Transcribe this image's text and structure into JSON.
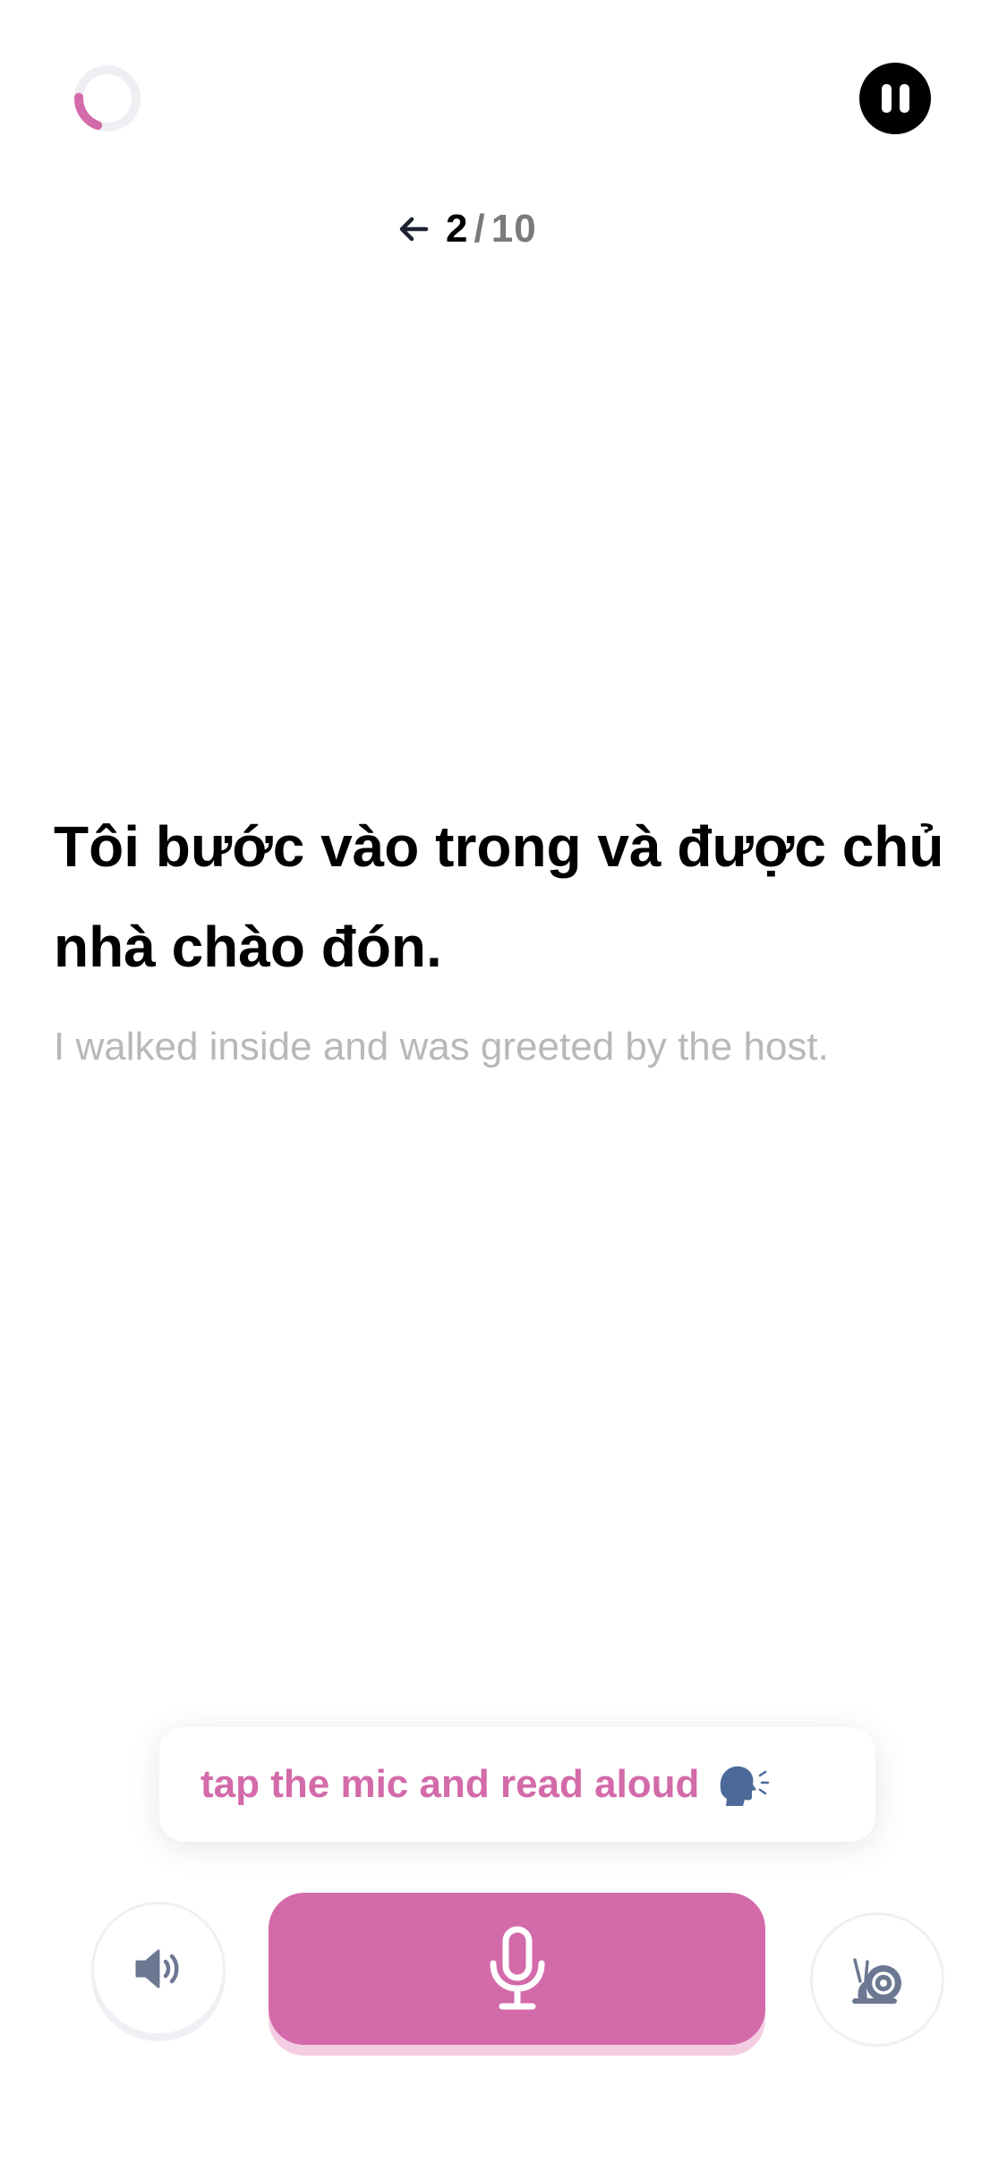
{
  "header": {
    "progress_ring": {
      "icon": "progress-ring-icon",
      "value": 0.2,
      "color": "#d36aa9",
      "track_color": "#efeef3"
    },
    "pause": {
      "icon": "pause-icon"
    },
    "counter": {
      "current": "2",
      "separator": "/",
      "total": "10",
      "back_icon": "arrow-left-icon"
    }
  },
  "lesson": {
    "sentence": "Tôi bước vào trong và được chủ nhà chào đón.",
    "translation": "I walked inside and was greeted by the host."
  },
  "hint": {
    "text": "tap the mic and read aloud",
    "icon": "speaking-head-icon"
  },
  "controls": {
    "speaker": {
      "icon": "speaker-icon"
    },
    "mic": {
      "icon": "microphone-icon"
    },
    "slow": {
      "icon": "snail-icon"
    }
  },
  "colors": {
    "accent": "#d36aa9",
    "accent_shadow": "#f5cde3",
    "icon_gray": "#6c7892"
  }
}
